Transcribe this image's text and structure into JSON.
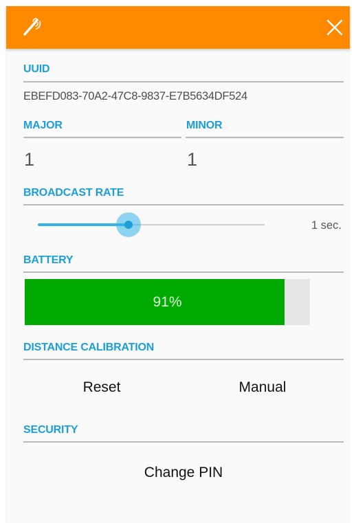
{
  "colors": {
    "header": "#ff8a00",
    "section_title": "#1a9fd8",
    "slider_accent": "#35b3e8",
    "battery_fill": "#00aa00"
  },
  "header": {
    "icon": "magic-wand-icon",
    "close_icon": "close-icon"
  },
  "uuid": {
    "label": "UUID",
    "value": "EBEFD083-70A2-47C8-9837-E7B5634DF524"
  },
  "major": {
    "label": "MAJOR",
    "value": "1"
  },
  "minor": {
    "label": "MINOR",
    "value": "1"
  },
  "broadcast_rate": {
    "label": "BROADCAST RATE",
    "value_text": "1 sec.",
    "slider_fraction": 0.4
  },
  "battery": {
    "label": "BATTERY",
    "percent_text": "91%",
    "level": 0.91
  },
  "distance_calibration": {
    "label": "DISTANCE CALIBRATION",
    "reset_label": "Reset",
    "manual_label": "Manual"
  },
  "security": {
    "label": "SECURITY",
    "change_pin_label": "Change PIN"
  }
}
